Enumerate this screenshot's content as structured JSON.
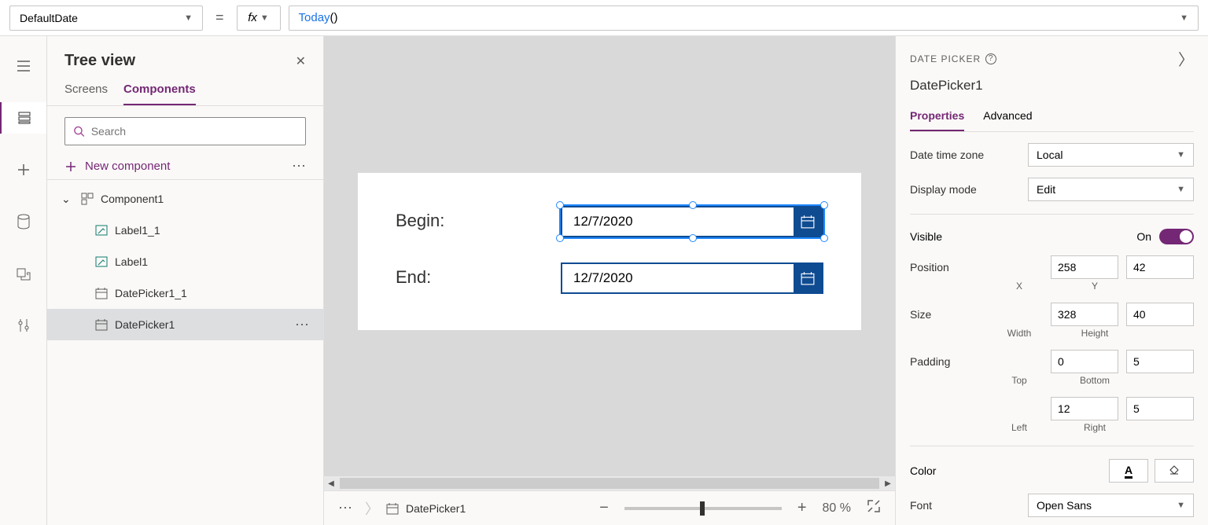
{
  "formula": {
    "property": "DefaultDate",
    "fx_label": "fx",
    "function_name": "Today",
    "parens": "()"
  },
  "tree": {
    "title": "Tree view",
    "tabs": {
      "screens": "Screens",
      "components": "Components"
    },
    "search_placeholder": "Search",
    "new_component": "New component",
    "nodes": {
      "component1": "Component1",
      "label1_1": "Label1_1",
      "label1": "Label1",
      "datepicker1_1": "DatePicker1_1",
      "datepicker1": "DatePicker1"
    }
  },
  "canvas": {
    "begin_label": "Begin:",
    "end_label": "End:",
    "begin_value": "12/7/2020",
    "end_value": "12/7/2020"
  },
  "status": {
    "crumb": "DatePicker1",
    "zoom_pct": "80",
    "zoom_unit": "%"
  },
  "props": {
    "type": "DATE PICKER",
    "name": "DatePicker1",
    "tabs": {
      "properties": "Properties",
      "advanced": "Advanced"
    },
    "dtz_label": "Date time zone",
    "dtz_value": "Local",
    "dm_label": "Display mode",
    "dm_value": "Edit",
    "visible_label": "Visible",
    "visible_state": "On",
    "position_label": "Position",
    "pos_x": "258",
    "pos_y": "42",
    "pos_x_label": "X",
    "pos_y_label": "Y",
    "size_label": "Size",
    "size_w": "328",
    "size_h": "40",
    "size_w_label": "Width",
    "size_h_label": "Height",
    "padding_label": "Padding",
    "pad_top": "0",
    "pad_bottom": "5",
    "pad_top_label": "Top",
    "pad_bottom_label": "Bottom",
    "pad_left": "12",
    "pad_right": "5",
    "pad_left_label": "Left",
    "pad_right_label": "Right",
    "color_label": "Color",
    "font_label": "Font",
    "font_value": "Open Sans"
  }
}
